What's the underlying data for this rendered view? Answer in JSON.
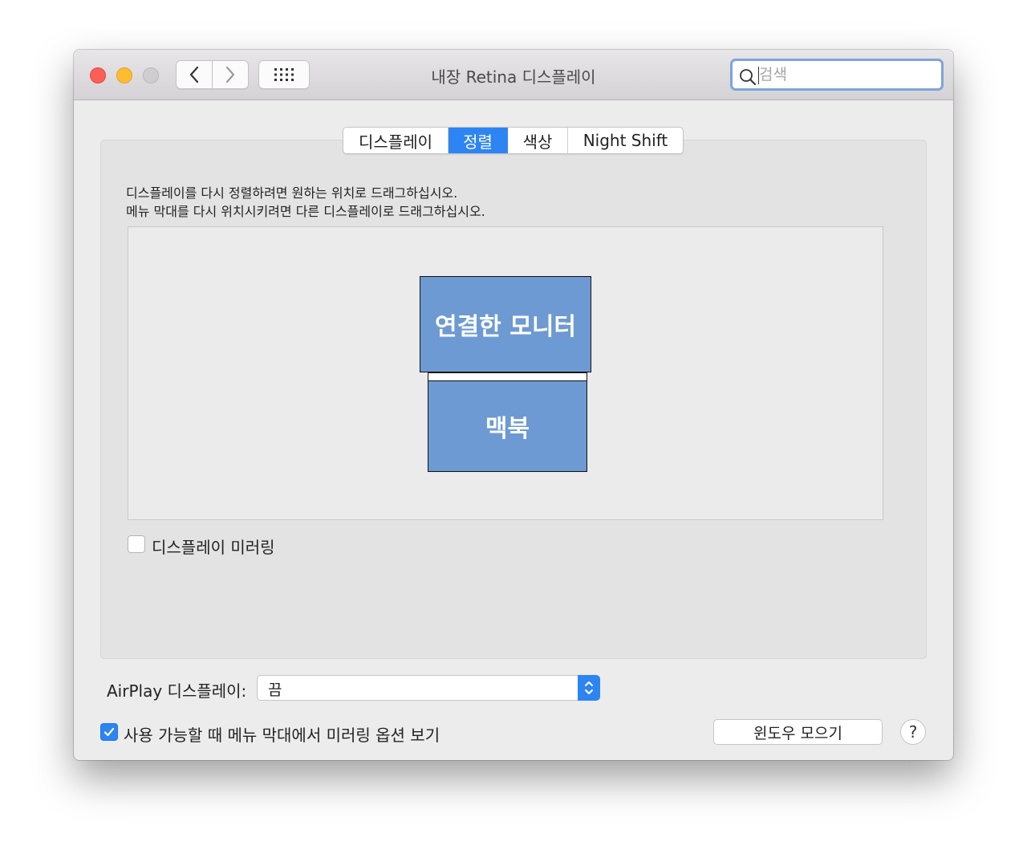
{
  "window": {
    "title": "내장 Retina 디스플레이"
  },
  "search": {
    "placeholder": "검색",
    "value": ""
  },
  "tabs": [
    {
      "label": "디스플레이",
      "active": false
    },
    {
      "label": "정렬",
      "active": true
    },
    {
      "label": "색상",
      "active": false
    },
    {
      "label": "Night Shift",
      "active": false
    }
  ],
  "instructions": {
    "line1": "디스플레이를 다시 정렬하려면 원하는 위치로 드래그하십시오.",
    "line2": "메뉴 막대를 다시 위치시키려면 다른 디스플레이로 드래그하십시오."
  },
  "displays": {
    "external": "연결한 모니터",
    "builtin": "맥북"
  },
  "mirroring": {
    "label": "디스플레이 미러링",
    "checked": false
  },
  "airplay": {
    "label": "AirPlay 디스플레이:",
    "value": "끔"
  },
  "show_mirroring_options": {
    "label": "사용 가능할 때 메뉴 막대에서 미러링 옵션 보기",
    "checked": true
  },
  "gather_windows_label": "윈도우 모으기",
  "help_label": "?",
  "colors": {
    "accent": "#2d84f3",
    "display_fill": "#6d9ad2"
  }
}
